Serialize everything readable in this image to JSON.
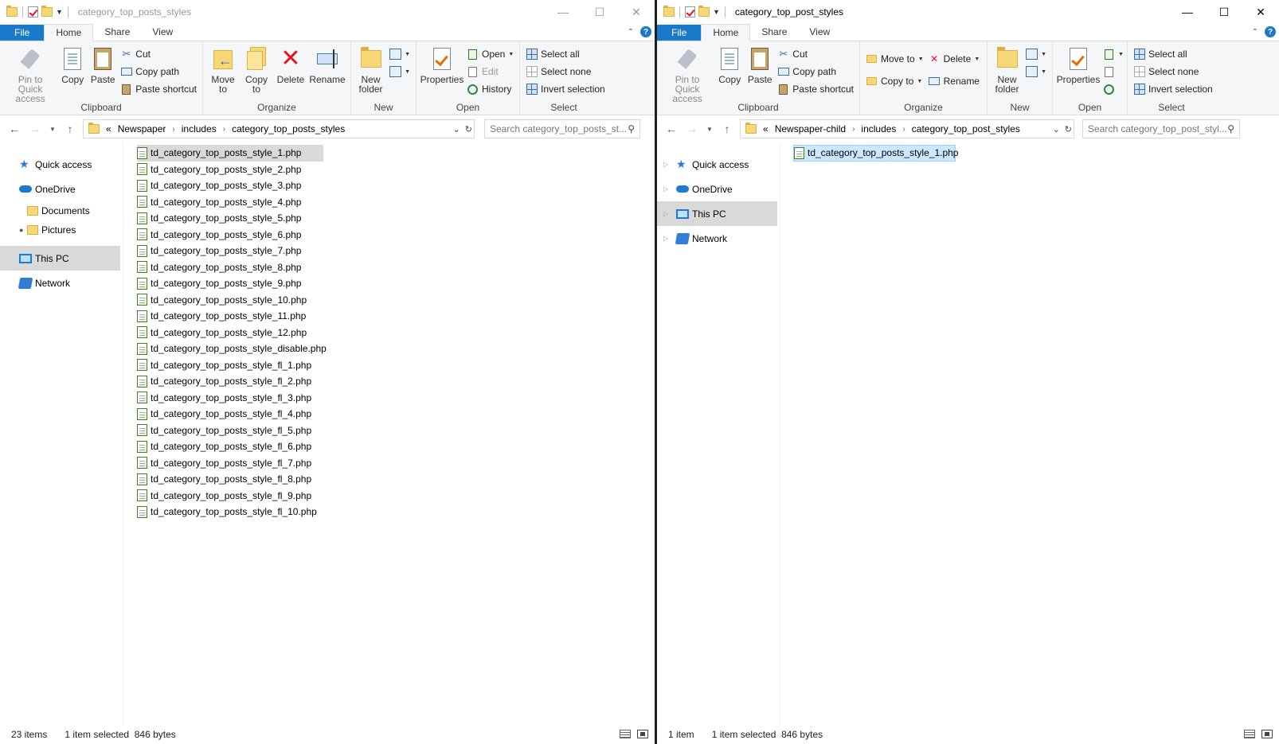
{
  "left": {
    "title": "category_top_posts_styles",
    "tabs": [
      "File",
      "Home",
      "Share",
      "View"
    ],
    "active_tab": "Home",
    "ribbon": {
      "pin": "Pin to Quick access",
      "copy": "Copy",
      "paste": "Paste",
      "cut": "Cut",
      "copy_path": "Copy path",
      "paste_shortcut": "Paste shortcut",
      "clipboard": "Clipboard",
      "move_to": "Move to",
      "copy_to": "Copy to",
      "delete": "Delete",
      "rename": "Rename",
      "organize": "Organize",
      "new_folder": "New folder",
      "new": "New",
      "properties": "Properties",
      "open": "Open",
      "edit": "Edit",
      "history": "History",
      "open_group": "Open",
      "select_all": "Select all",
      "select_none": "Select none",
      "invert_selection": "Invert selection",
      "select": "Select"
    },
    "address": {
      "prefix": "«",
      "crumbs": [
        "Newspaper",
        "includes",
        "category_top_posts_styles"
      ]
    },
    "search_placeholder": "Search category_top_posts_st...",
    "nav": {
      "quick_access": "Quick access",
      "onedrive": "OneDrive",
      "documents": "Documents",
      "pictures": "Pictures",
      "this_pc": "This PC",
      "network": "Network"
    },
    "files": [
      "td_category_top_posts_style_1.php",
      "td_category_top_posts_style_2.php",
      "td_category_top_posts_style_3.php",
      "td_category_top_posts_style_4.php",
      "td_category_top_posts_style_5.php",
      "td_category_top_posts_style_6.php",
      "td_category_top_posts_style_7.php",
      "td_category_top_posts_style_8.php",
      "td_category_top_posts_style_9.php",
      "td_category_top_posts_style_10.php",
      "td_category_top_posts_style_11.php",
      "td_category_top_posts_style_12.php",
      "td_category_top_posts_style_disable.php",
      "td_category_top_posts_style_fl_1.php",
      "td_category_top_posts_style_fl_2.php",
      "td_category_top_posts_style_fl_3.php",
      "td_category_top_posts_style_fl_4.php",
      "td_category_top_posts_style_fl_5.php",
      "td_category_top_posts_style_fl_6.php",
      "td_category_top_posts_style_fl_7.php",
      "td_category_top_posts_style_fl_8.php",
      "td_category_top_posts_style_fl_9.php",
      "td_category_top_posts_style_fl_10.php"
    ],
    "status": {
      "count": "23 items",
      "selected": "1 item selected",
      "size": "846 bytes"
    }
  },
  "right": {
    "title": "category_top_post_styles",
    "tabs": [
      "File",
      "Home",
      "Share",
      "View"
    ],
    "active_tab": "Home",
    "ribbon": {
      "pin": "Pin to Quick access",
      "copy": "Copy",
      "paste": "Paste",
      "cut": "Cut",
      "copy_path": "Copy path",
      "paste_shortcut": "Paste shortcut",
      "clipboard": "Clipboard",
      "move_to": "Move to",
      "copy_to": "Copy to",
      "delete": "Delete",
      "rename": "Rename",
      "organize": "Organize",
      "new_folder": "New folder",
      "new": "New",
      "properties": "Properties",
      "open_group": "Open",
      "select_all": "Select all",
      "select_none": "Select none",
      "invert_selection": "Invert selection",
      "select": "Select"
    },
    "address": {
      "prefix": "«",
      "crumbs": [
        "Newspaper-child",
        "includes",
        "category_top_post_styles"
      ]
    },
    "search_placeholder": "Search category_top_post_styl...",
    "nav": {
      "quick_access": "Quick access",
      "onedrive": "OneDrive",
      "this_pc": "This PC",
      "network": "Network"
    },
    "files": [
      "td_category_top_posts_style_1.php"
    ],
    "status": {
      "count": "1 item",
      "selected": "1 item selected",
      "size": "846 bytes"
    }
  },
  "icons": {
    "minimize": "minimize-icon",
    "maximize": "maximize-icon",
    "close": "close-icon",
    "help": "help-icon",
    "refresh": "refresh-icon",
    "search": "search-icon",
    "details_view": "details-view-icon",
    "tiles_view": "large-icons-view-icon"
  },
  "colors": {
    "accent": "#1979ca",
    "selection": "#cce8ff",
    "selected_gray": "#d9d9d9"
  }
}
